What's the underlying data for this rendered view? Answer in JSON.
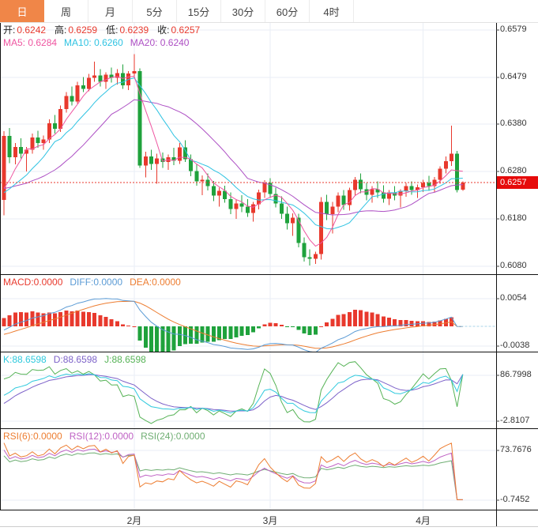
{
  "toolbar": {
    "tabs": [
      {
        "label": "日",
        "name": "tab-day",
        "selected": true
      },
      {
        "label": "周",
        "name": "tab-week",
        "selected": false
      },
      {
        "label": "月",
        "name": "tab-month",
        "selected": false
      },
      {
        "label": "5分",
        "name": "tab-5min",
        "selected": false
      },
      {
        "label": "15分",
        "name": "tab-15min",
        "selected": false
      },
      {
        "label": "30分",
        "name": "tab-30min",
        "selected": false
      },
      {
        "label": "60分",
        "name": "tab-60min",
        "selected": false
      },
      {
        "label": "4时",
        "name": "tab-4hour",
        "selected": false
      }
    ]
  },
  "colors": {
    "up": "#e8392d",
    "down": "#1fa23c",
    "ma5": "#ee55a0",
    "ma10": "#2fc3e2",
    "ma20": "#ad4fc4",
    "diff": "#5b9bd5",
    "dea": "#ed7d31",
    "k": "#2ec9dd",
    "d": "#7d62c9",
    "j": "#56b356",
    "rsi6": "#ed7d31",
    "rsi12": "#bf62c4",
    "rsi24": "#6fae73",
    "grid": "#e9eef5",
    "label": "#222222",
    "axis_text": "#333333",
    "badge": "#e60b0b",
    "tab_active_bg": "#f08648",
    "dashed_zero": "#a8d4e8",
    "separator": "#111111",
    "top_line": "#888888"
  },
  "legends": {
    "ohlc": [
      {
        "label": "开:",
        "value": "0.6242"
      },
      {
        "label": "高:",
        "value": "0.6259"
      },
      {
        "label": "低:",
        "value": "0.6239"
      },
      {
        "label": "收:",
        "value": "0.6257"
      }
    ],
    "ma": [
      {
        "text": "MA5: 0.6284",
        "color_key": "ma5"
      },
      {
        "text": "MA10: 0.6260",
        "color_key": "ma10"
      },
      {
        "text": "MA20: 0.6240",
        "color_key": "ma20"
      }
    ],
    "macd": [
      {
        "text": "MACD:0.0000",
        "color_key": "up"
      },
      {
        "text": "DIFF:0.0000",
        "color_key": "diff"
      },
      {
        "text": "DEA:0.0000",
        "color_key": "dea"
      }
    ],
    "kdj": [
      {
        "text": "K:88.6598",
        "color_key": "k"
      },
      {
        "text": "D:88.6598",
        "color_key": "d"
      },
      {
        "text": "J:88.6598",
        "color_key": "j"
      }
    ],
    "rsi": [
      {
        "text": "RSI(6):0.0000",
        "color_key": "rsi6"
      },
      {
        "text": "RSI(12):0.0000",
        "color_key": "rsi12"
      },
      {
        "text": "RSI(24):0.0000",
        "color_key": "rsi24"
      }
    ]
  },
  "chart_data": {
    "type": "candlestick",
    "title": "",
    "x_axis": {
      "labels": [
        "2月",
        "3月",
        "4月"
      ],
      "indices": [
        23,
        47,
        74
      ]
    },
    "panels": {
      "price": {
        "y_ticks": [
          {
            "label": "0.6579",
            "value": 0.6579
          },
          {
            "label": "0.6479",
            "value": 0.6479
          },
          {
            "label": "0.6380",
            "value": 0.638
          },
          {
            "label": "0.6280",
            "value": 0.628
          },
          {
            "label": "0.6180",
            "value": 0.618
          },
          {
            "label": "0.6080",
            "value": 0.608
          }
        ],
        "current_price": {
          "label": "0.6257",
          "value": 0.6257
        },
        "ma_periods": [
          5,
          10,
          20
        ],
        "last_values": {
          "open": 0.6242,
          "high": 0.6259,
          "low": 0.6239,
          "close": 0.6257,
          "ma5": 0.6284,
          "ma10": 0.626,
          "ma20": 0.624
        }
      },
      "macd": {
        "y_ticks": [
          {
            "label": "0.0054",
            "value": 0.0054
          },
          {
            "label": "-0.0038",
            "value": -0.0038
          }
        ],
        "last_values": {
          "macd": 0.0,
          "diff": 0.0,
          "dea": 0.0
        },
        "zero_tail_from_index": 80
      },
      "kdj": {
        "y_ticks": [
          {
            "label": "86.7998",
            "value": 86.7998
          },
          {
            "label": "-2.8107",
            "value": -2.8107
          }
        ],
        "last_values": {
          "k": 88.6598,
          "d": 88.6598,
          "j": 88.6598
        }
      },
      "rsi": {
        "y_ticks": [
          {
            "label": "73.7676",
            "value": 73.7676
          },
          {
            "label": "-0.7452",
            "value": -0.7452
          }
        ],
        "last_values": {
          "rsi6": 0.0,
          "rsi12": 0.0,
          "rsi24": 0.0
        },
        "tail_zero_from_index": 80
      }
    },
    "candles": [
      [
        0.622,
        0.6365,
        0.6188,
        0.6355
      ],
      [
        0.6355,
        0.6372,
        0.6298,
        0.631
      ],
      [
        0.631,
        0.634,
        0.6295,
        0.6332
      ],
      [
        0.6332,
        0.635,
        0.6308,
        0.6318
      ],
      [
        0.6318,
        0.6332,
        0.628,
        0.6326
      ],
      [
        0.6326,
        0.636,
        0.6318,
        0.6352
      ],
      [
        0.6352,
        0.6366,
        0.633,
        0.634
      ],
      [
        0.634,
        0.6356,
        0.6326,
        0.6348
      ],
      [
        0.6348,
        0.639,
        0.634,
        0.6382
      ],
      [
        0.6382,
        0.64,
        0.636,
        0.637
      ],
      [
        0.637,
        0.642,
        0.6364,
        0.6412
      ],
      [
        0.6412,
        0.6448,
        0.6405,
        0.644
      ],
      [
        0.644,
        0.646,
        0.642,
        0.6428
      ],
      [
        0.6428,
        0.647,
        0.6424,
        0.6462
      ],
      [
        0.6462,
        0.648,
        0.6448,
        0.6455
      ],
      [
        0.6455,
        0.6486,
        0.645,
        0.6478
      ],
      [
        0.6478,
        0.6512,
        0.647,
        0.6483
      ],
      [
        0.6483,
        0.6496,
        0.646,
        0.647
      ],
      [
        0.647,
        0.649,
        0.6455,
        0.6485
      ],
      [
        0.6485,
        0.65,
        0.6468,
        0.6478
      ],
      [
        0.6478,
        0.6496,
        0.6464,
        0.6488
      ],
      [
        0.6488,
        0.6506,
        0.6455,
        0.6462
      ],
      [
        0.6462,
        0.6492,
        0.6452,
        0.6487
      ],
      [
        0.6487,
        0.6528,
        0.6478,
        0.6492
      ],
      [
        0.6492,
        0.6498,
        0.6288,
        0.6293
      ],
      [
        0.6293,
        0.6322,
        0.6268,
        0.6312
      ],
      [
        0.6312,
        0.6326,
        0.6284,
        0.6296
      ],
      [
        0.6296,
        0.6318,
        0.6254,
        0.6308
      ],
      [
        0.6308,
        0.632,
        0.6288,
        0.63
      ],
      [
        0.63,
        0.6316,
        0.6284,
        0.631
      ],
      [
        0.631,
        0.633,
        0.6294,
        0.6303
      ],
      [
        0.6303,
        0.634,
        0.6296,
        0.6331
      ],
      [
        0.6331,
        0.6346,
        0.63,
        0.6306
      ],
      [
        0.6306,
        0.6316,
        0.627,
        0.6281
      ],
      [
        0.6281,
        0.6296,
        0.625,
        0.6259
      ],
      [
        0.6259,
        0.6272,
        0.623,
        0.6263
      ],
      [
        0.6263,
        0.6276,
        0.624,
        0.6249
      ],
      [
        0.6249,
        0.626,
        0.6218,
        0.6229
      ],
      [
        0.6229,
        0.6246,
        0.6206,
        0.6239
      ],
      [
        0.6239,
        0.625,
        0.6214,
        0.6222
      ],
      [
        0.6222,
        0.6236,
        0.619,
        0.6201
      ],
      [
        0.6201,
        0.622,
        0.618,
        0.6213
      ],
      [
        0.6213,
        0.623,
        0.6194,
        0.6206
      ],
      [
        0.6206,
        0.6222,
        0.6184,
        0.6193
      ],
      [
        0.6193,
        0.6216,
        0.6174,
        0.6211
      ],
      [
        0.6211,
        0.6242,
        0.62,
        0.6236
      ],
      [
        0.6236,
        0.6262,
        0.6224,
        0.6256
      ],
      [
        0.6256,
        0.6266,
        0.6224,
        0.6233
      ],
      [
        0.6233,
        0.6246,
        0.6204,
        0.6213
      ],
      [
        0.6213,
        0.6228,
        0.618,
        0.6191
      ],
      [
        0.6191,
        0.6206,
        0.6158,
        0.6171
      ],
      [
        0.6171,
        0.6192,
        0.6144,
        0.6183
      ],
      [
        0.6183,
        0.6191,
        0.612,
        0.6129
      ],
      [
        0.6129,
        0.6141,
        0.609,
        0.6099
      ],
      [
        0.6099,
        0.6116,
        0.6082,
        0.6096
      ],
      [
        0.6096,
        0.6111,
        0.6085,
        0.6106
      ],
      [
        0.6106,
        0.6226,
        0.6094,
        0.6216
      ],
      [
        0.6216,
        0.6231,
        0.6178,
        0.619
      ],
      [
        0.619,
        0.6216,
        0.6149,
        0.6206
      ],
      [
        0.6206,
        0.6236,
        0.6194,
        0.6229
      ],
      [
        0.6229,
        0.6241,
        0.6199,
        0.6209
      ],
      [
        0.6209,
        0.6246,
        0.6198,
        0.6241
      ],
      [
        0.6241,
        0.6269,
        0.6229,
        0.6263
      ],
      [
        0.6263,
        0.6276,
        0.6234,
        0.6243
      ],
      [
        0.6243,
        0.6256,
        0.6219,
        0.6231
      ],
      [
        0.6231,
        0.6249,
        0.6214,
        0.6243
      ],
      [
        0.6243,
        0.6259,
        0.6224,
        0.6236
      ],
      [
        0.6236,
        0.6251,
        0.6214,
        0.6223
      ],
      [
        0.6223,
        0.6241,
        0.6209,
        0.6236
      ],
      [
        0.6236,
        0.6249,
        0.6219,
        0.6229
      ],
      [
        0.6229,
        0.6243,
        0.6204,
        0.6239
      ],
      [
        0.6239,
        0.6256,
        0.6227,
        0.6249
      ],
      [
        0.6249,
        0.6259,
        0.6231,
        0.6241
      ],
      [
        0.6241,
        0.6253,
        0.6224,
        0.6247
      ],
      [
        0.6247,
        0.6263,
        0.6237,
        0.6256
      ],
      [
        0.6256,
        0.6271,
        0.6239,
        0.6249
      ],
      [
        0.6249,
        0.6269,
        0.6237,
        0.6263
      ],
      [
        0.6263,
        0.6291,
        0.6254,
        0.6286
      ],
      [
        0.6286,
        0.6312,
        0.6276,
        0.6302
      ],
      [
        0.6302,
        0.6377,
        0.6292,
        0.6318
      ],
      [
        0.6318,
        0.6324,
        0.6236,
        0.6241
      ],
      [
        0.6242,
        0.6259,
        0.6239,
        0.6257
      ]
    ]
  }
}
